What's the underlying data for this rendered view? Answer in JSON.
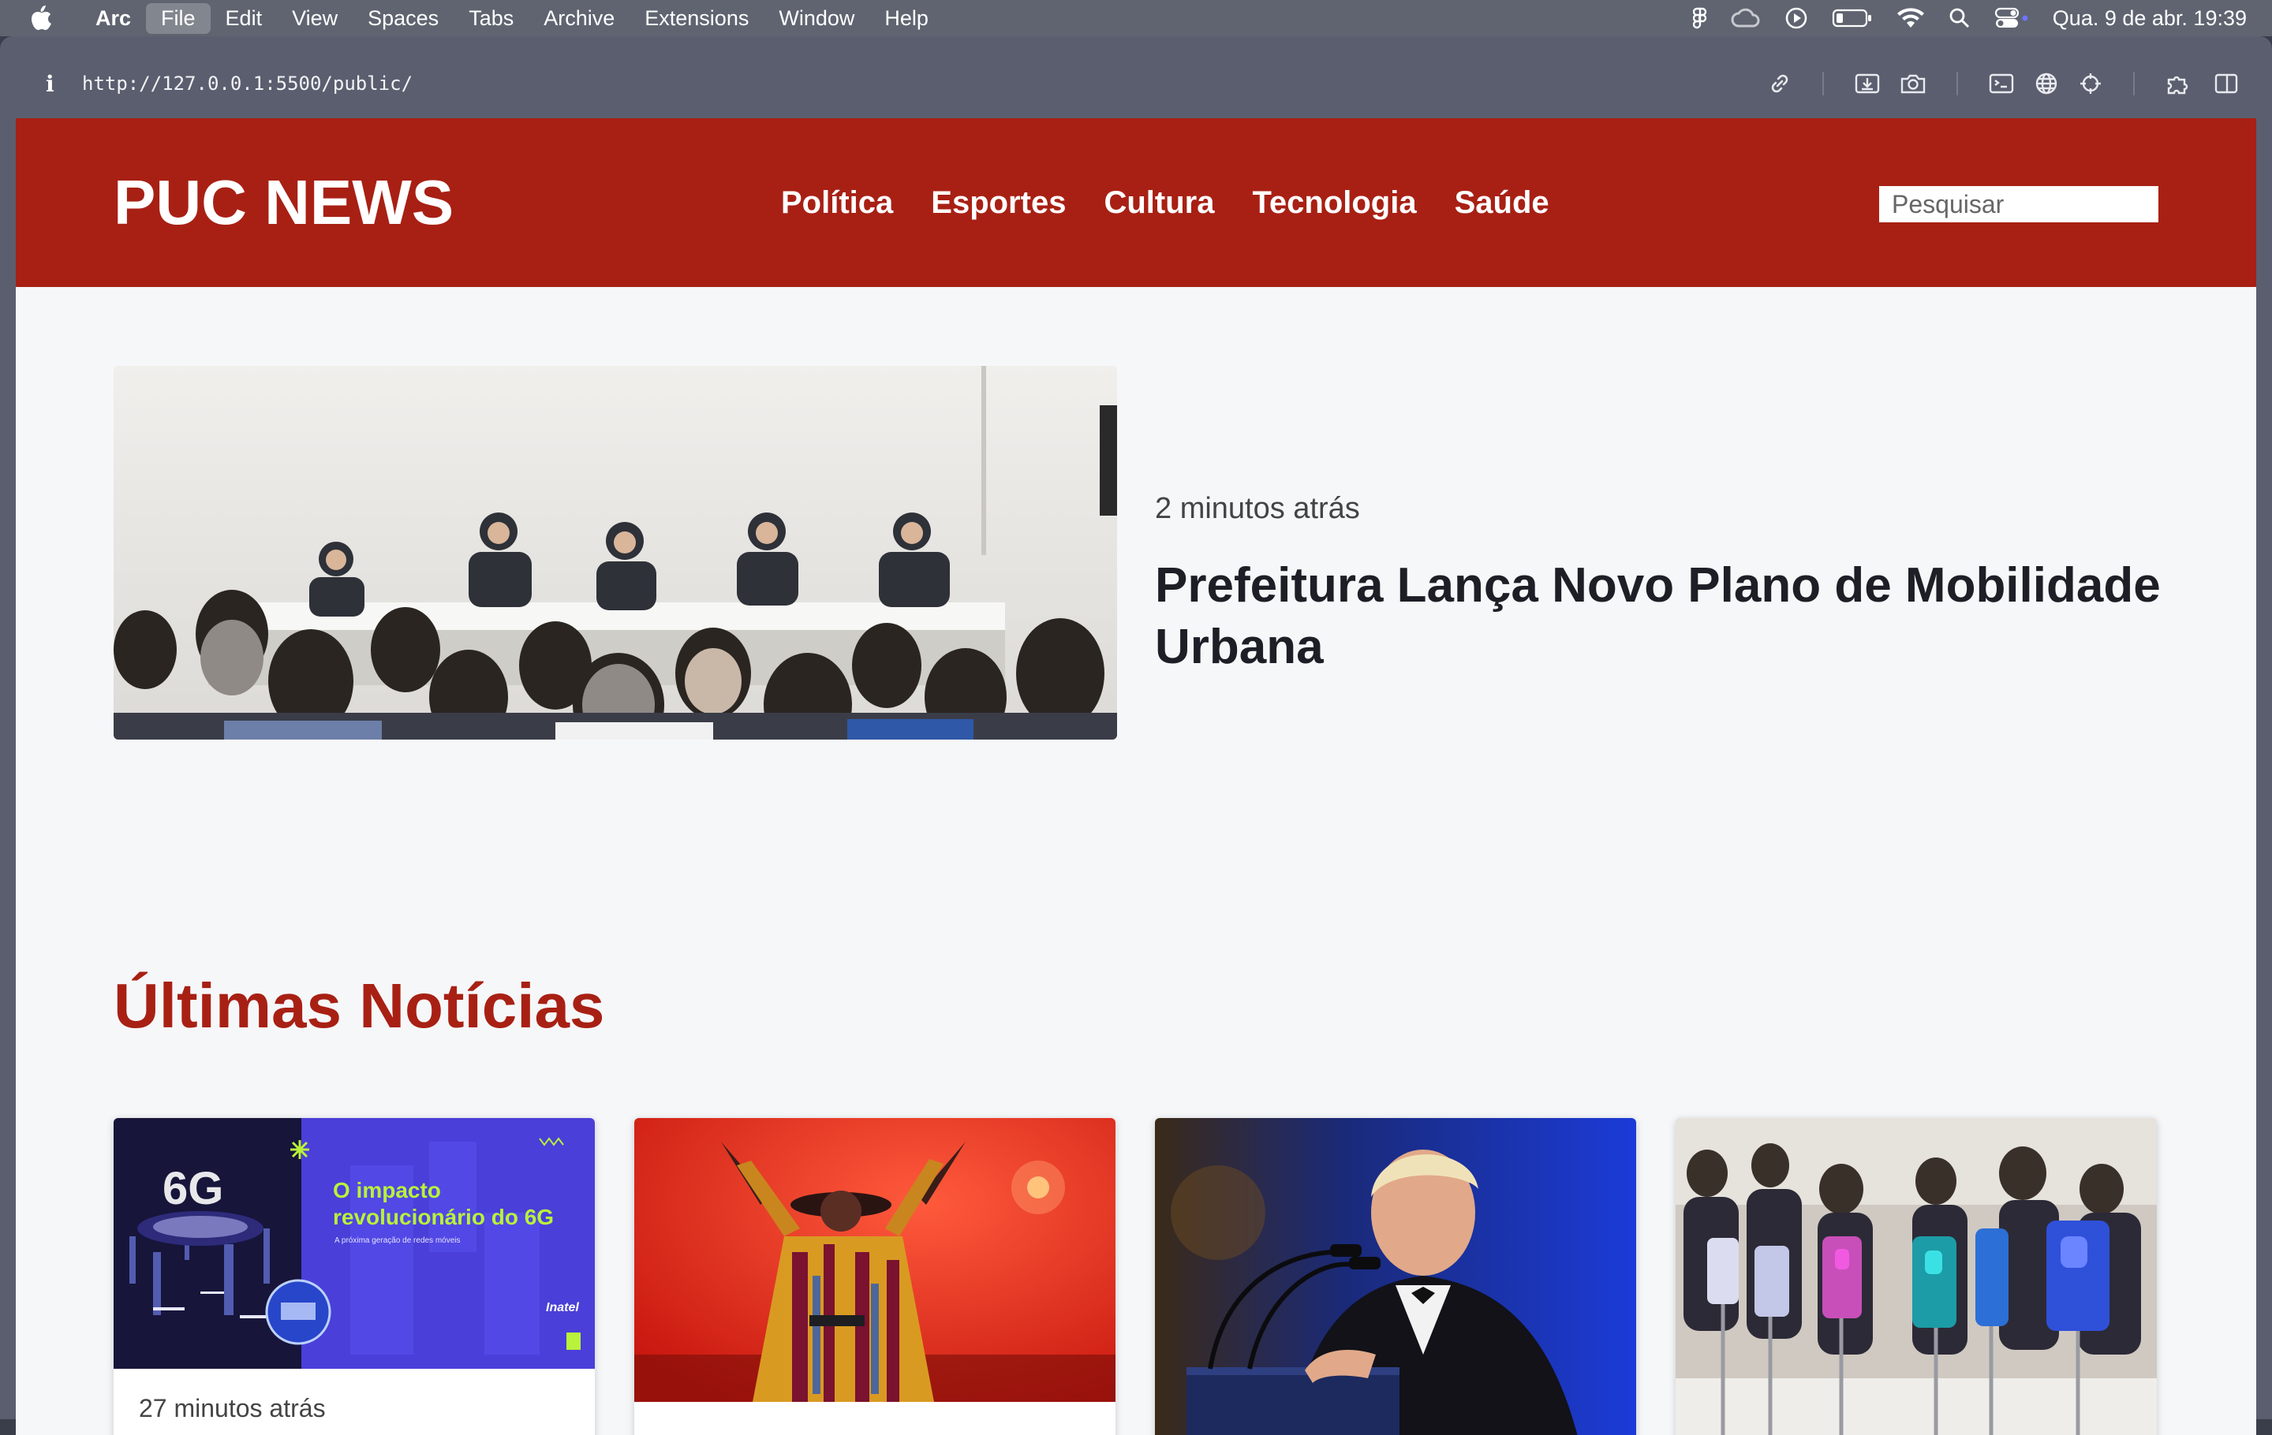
{
  "menubar": {
    "items": [
      "Arc",
      "File",
      "Edit",
      "View",
      "Spaces",
      "Tabs",
      "Archive",
      "Extensions",
      "Window",
      "Help"
    ],
    "active_item": "File",
    "clock": "Qua. 9 de abr.  19:39",
    "status_icons": [
      "figma-icon",
      "creative-cloud-icon",
      "play-icon",
      "battery-icon",
      "wifi-icon",
      "search-icon",
      "control-center-icon"
    ]
  },
  "toolbar": {
    "info_glyph": "i",
    "url": "http://127.0.0.1:5500/public/",
    "tool_icons": [
      "link-icon",
      "capture-icon",
      "camera-icon",
      "terminal-icon",
      "globe-icon",
      "target-icon",
      "extensions-icon",
      "sidebar-icon"
    ]
  },
  "site": {
    "logo": "PUC NEWS",
    "nav": [
      "Política",
      "Esportes",
      "Cultura",
      "Tecnologia",
      "Saúde"
    ],
    "search_placeholder": "Pesquisar",
    "brand_color": "#a82014"
  },
  "hero": {
    "time": "2 minutos atrás",
    "title": "Prefeitura Lança Novo Plano de Mobilidade Urbana"
  },
  "latest": {
    "title": "Últimas Notícias",
    "cards": [
      {
        "time": "27 minutos atrás",
        "thumb_badge": "6G",
        "thumb_headline_1": "O impacto",
        "thumb_headline_2": "revolucionário do 6G",
        "thumb_sub": "A próxima geração de redes móveis",
        "thumb_brand": "Inatel"
      },
      {
        "time": ""
      },
      {
        "time": ""
      },
      {
        "time": ""
      }
    ]
  }
}
